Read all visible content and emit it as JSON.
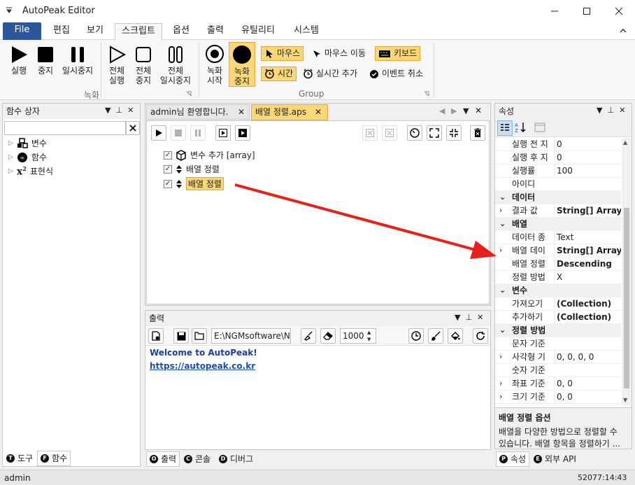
{
  "window": {
    "title": "AutoPeak Editor"
  },
  "ribbon_tabs": [
    "File",
    "편집",
    "보기",
    "스크립트",
    "옵션",
    "출력",
    "유틸리티",
    "시스템"
  ],
  "ribbon": {
    "run": "실행",
    "stop": "중지",
    "pause": "일시중지",
    "run_all_1": "전체",
    "run_all_2": "실행",
    "stop_all_1": "전체",
    "stop_all_2": "중지",
    "pause_all_1": "전체",
    "pause_all_2": "일시중지",
    "group_record": "녹화",
    "rec_start_1": "녹화",
    "rec_start_2": "시작",
    "rec_stop_1": "녹화",
    "rec_stop_2": "중지",
    "mouse_click": "마우스",
    "mouse_move": "마우스 이동",
    "keyboard": "키보드",
    "time": "시간",
    "realtime_add": "실시간 추가",
    "event_cancel": "이벤트 취소",
    "group_group": "Group"
  },
  "left_panel": {
    "title": "함수 상자",
    "search_placeholder": "",
    "items": [
      {
        "label": "변수",
        "icon": "variable-icon"
      },
      {
        "label": "함수",
        "icon": "function-icon"
      },
      {
        "label": "표현식",
        "icon": "expression-icon"
      }
    ],
    "bottom_tabs": [
      {
        "badge": "T",
        "label": "도구"
      },
      {
        "badge": "F",
        "label": "함수"
      }
    ]
  },
  "editor": {
    "tabs": [
      {
        "label": "admin님 환영합니다.",
        "active": false
      },
      {
        "label": "배열 정렬.aps",
        "active": true
      }
    ],
    "items": [
      {
        "label": "변수 추가 [array]",
        "checked": true,
        "icon": "cube-icon"
      },
      {
        "label": "배열 정렬",
        "checked": true,
        "icon": "sort-arrows-icon"
      },
      {
        "label": "배열 정렬",
        "checked": true,
        "icon": "sort-arrows-icon",
        "selected": true
      }
    ]
  },
  "output": {
    "title": "출력",
    "path": "E:\\NGMsoftware\\NG",
    "count": "1000",
    "lines": [
      "Welcome to AutoPeak!",
      "https://autopeak.co.kr"
    ],
    "bottom_tabs": [
      {
        "badge": "O",
        "label": "출력"
      },
      {
        "badge": "C",
        "label": "콘솔"
      },
      {
        "badge": "D",
        "label": "디버그"
      }
    ]
  },
  "properties": {
    "title": "속성",
    "rows": [
      {
        "key": "실행 전 지",
        "value": "0",
        "type": "prop"
      },
      {
        "key": "실행 후 지",
        "value": "0",
        "type": "prop"
      },
      {
        "key": "실행률",
        "value": "100",
        "type": "prop"
      },
      {
        "key": "아이디",
        "value": "",
        "type": "prop"
      },
      {
        "key": "데이터",
        "value": "",
        "type": "cat"
      },
      {
        "key": "결과 값",
        "value": "String[] Array",
        "type": "prop",
        "bold": true,
        "expand": true
      },
      {
        "key": "배열",
        "value": "",
        "type": "cat"
      },
      {
        "key": "데이터 종",
        "value": "Text",
        "type": "prop"
      },
      {
        "key": "배열 데이",
        "value": "String[] Array",
        "type": "prop",
        "bold": true,
        "expand": true
      },
      {
        "key": "배열 정렬",
        "value": "Descending",
        "type": "prop",
        "bold": true
      },
      {
        "key": "정렬 방법",
        "value": "X",
        "type": "prop"
      },
      {
        "key": "변수",
        "value": "",
        "type": "cat"
      },
      {
        "key": "가져오기",
        "value": "(Collection)",
        "type": "prop",
        "bold": true
      },
      {
        "key": "추가하기",
        "value": "(Collection)",
        "type": "prop",
        "bold": true
      },
      {
        "key": "정렬 방법",
        "value": "",
        "type": "cat"
      },
      {
        "key": "문자 기준",
        "value": "",
        "type": "prop"
      },
      {
        "key": "사각형 기",
        "value": "0, 0, 0, 0",
        "type": "prop",
        "expand": true
      },
      {
        "key": "숫자 기준",
        "value": "",
        "type": "prop"
      },
      {
        "key": "좌표 기준",
        "value": "0, 0",
        "type": "prop",
        "expand": true
      },
      {
        "key": "크기 기준",
        "value": "0, 0",
        "type": "prop",
        "expand": true
      }
    ],
    "desc_title": "배열 정렬 옵션",
    "desc_line1": "배열을 다양한 방법으로 정렬할 수",
    "desc_line2": "있습니다. 배열 항목을 정렬하기 ...",
    "bottom_tabs": [
      {
        "badge": "P",
        "label": "속성"
      },
      {
        "badge": "E",
        "label": "외부 API"
      }
    ]
  },
  "status": {
    "user": "admin",
    "time": "52077:14:43"
  },
  "colors": {
    "accent": "#2b579a",
    "highlight": "#fbd778",
    "arrow": "#e8201a",
    "link": "#1b4fb5"
  }
}
